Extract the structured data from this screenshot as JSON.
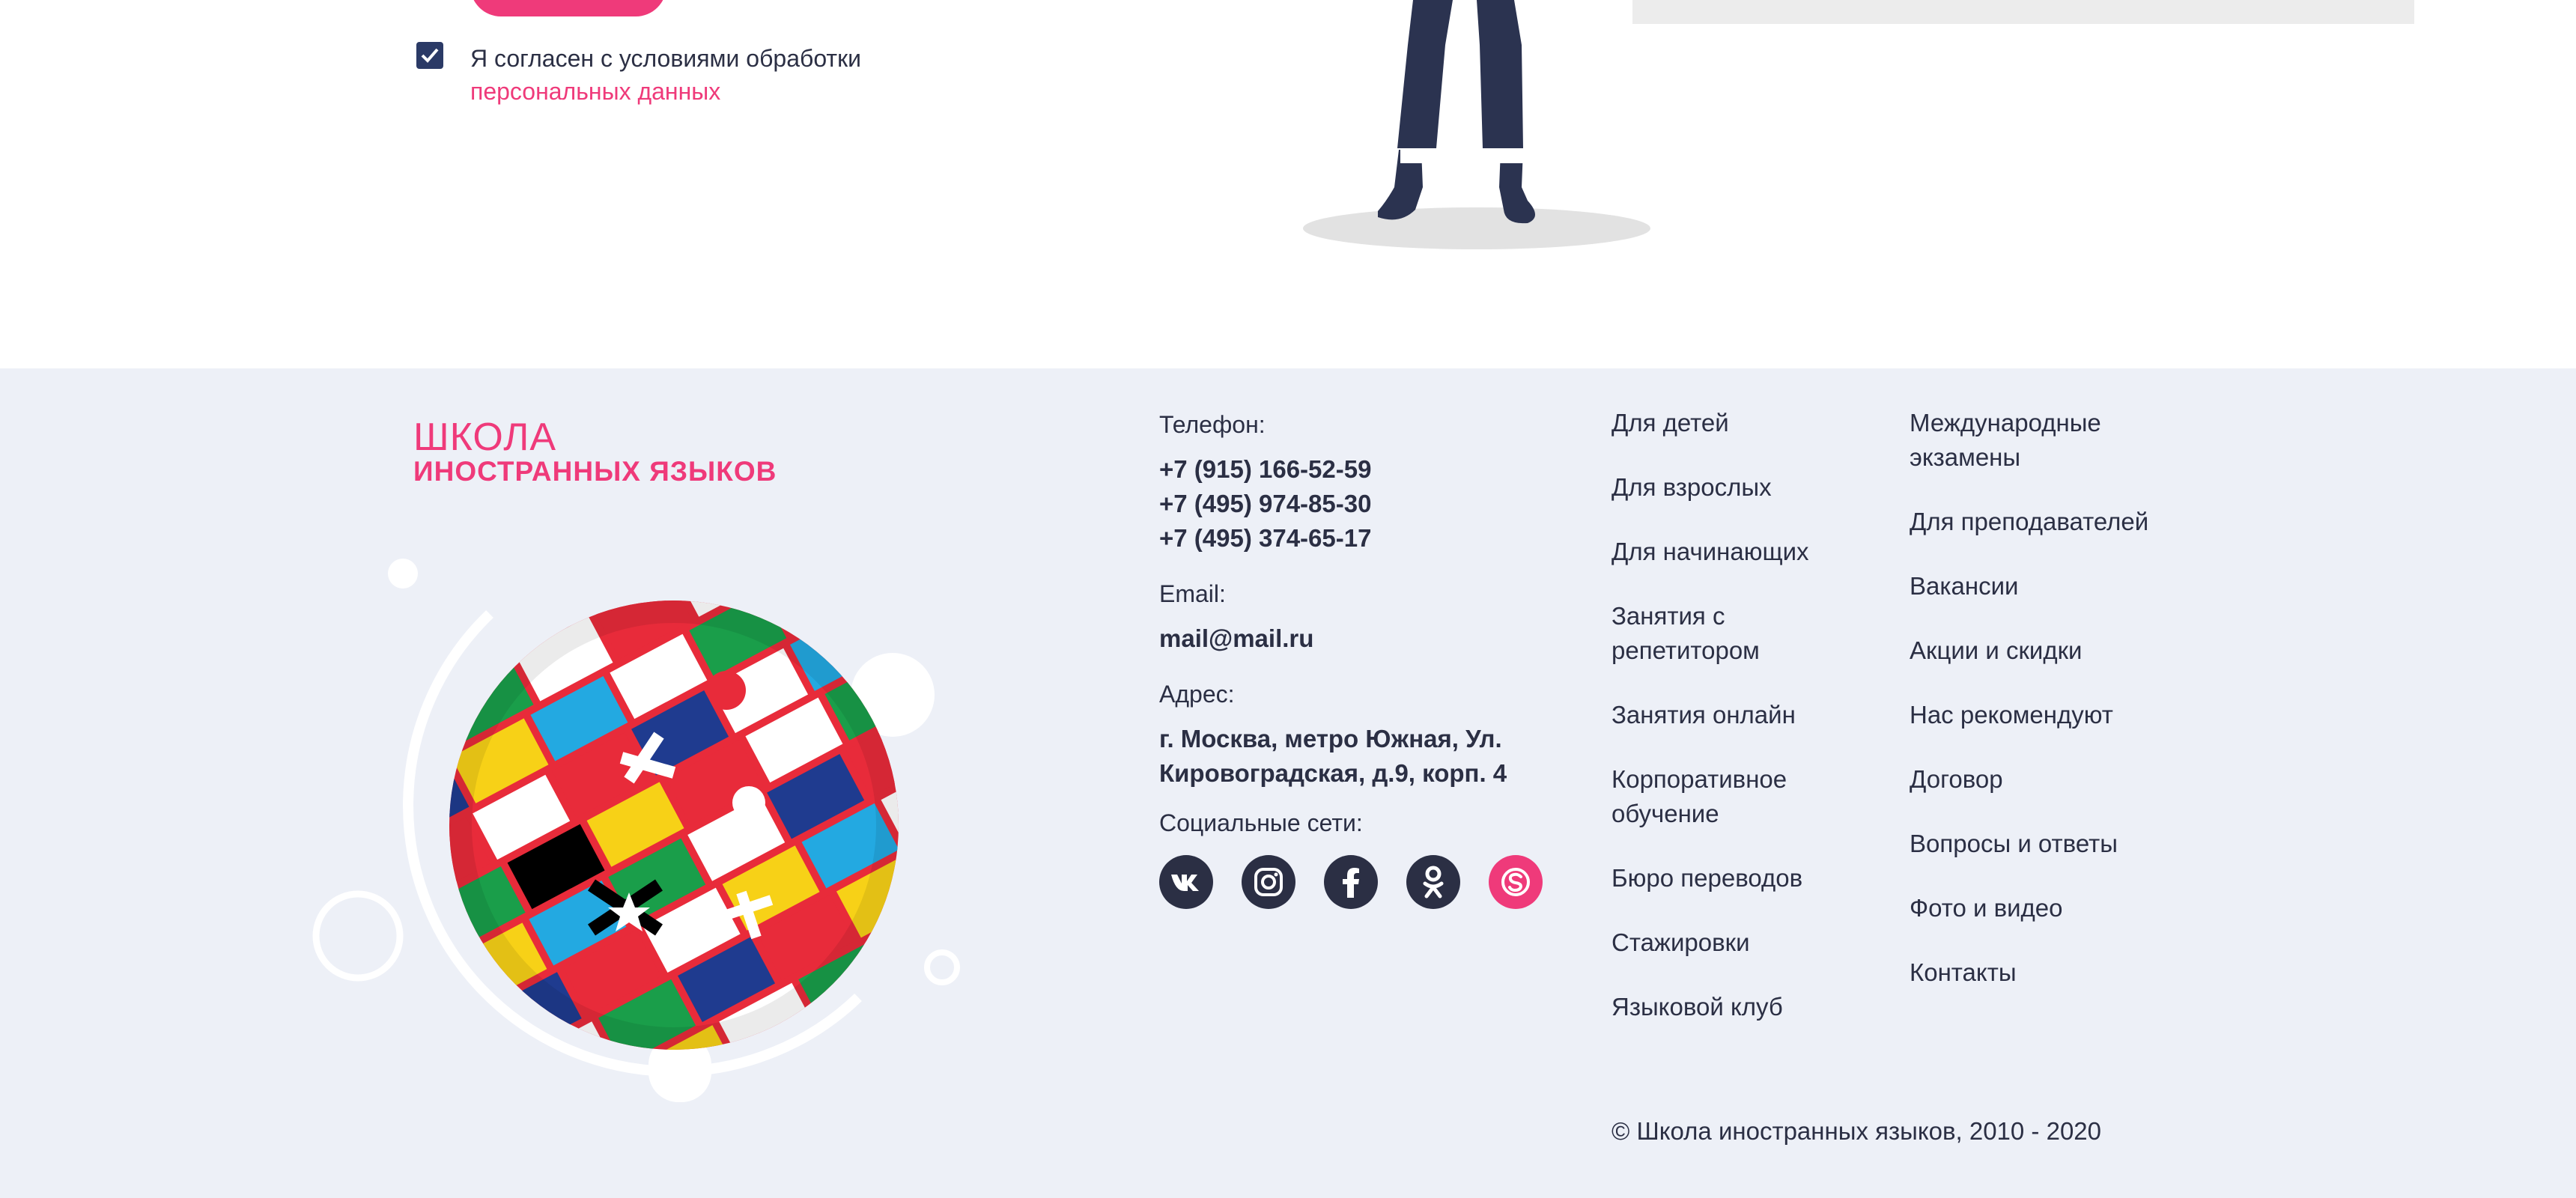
{
  "consent": {
    "text": "Я согласен с условиями обработки",
    "link": "персональных данных",
    "checked": true
  },
  "logo": {
    "line1": "ШКОЛА",
    "line2": "ИНОСТРАННЫХ ЯЗЫКОВ"
  },
  "contacts": {
    "phone_label": "Телефон:",
    "phones": [
      "+7 (915) 166-52-59",
      "+7 (495) 974-85-30",
      "+7 (495) 374-65-17"
    ],
    "email_label": "Email:",
    "email": "mail@mail.ru",
    "address_label": "Адрес:",
    "address_line1": "г. Москва, метро Южная, Ул.",
    "address_line2": "Кировоградская, д.9, корп. 4",
    "social_label": "Социальные сети:",
    "socials": [
      "vk-icon",
      "instagram-icon",
      "facebook-icon",
      "odnoklassniki-icon",
      "skype-icon"
    ]
  },
  "menu1": [
    "Для детей",
    "Для взрослых",
    "Для начинающих",
    "Занятия с репетитором",
    "Занятия онлайн",
    "Корпоративное обучение",
    "Бюро переводов",
    "Стажировки",
    "Языковой клуб"
  ],
  "menu2": [
    "Международные экзамены",
    "Для преподавателей",
    "Вакансии",
    "Акции и скидки",
    "Нас рекомендуют",
    "Договор",
    "Вопросы и ответы",
    "Фото и видео",
    "Контакты"
  ],
  "copyright": "© Школа иностранных языков, 2010 - 2020",
  "colors": {
    "accent": "#ef3a7a",
    "dark": "#2b2f44",
    "footer_bg": "#edf0f7"
  }
}
